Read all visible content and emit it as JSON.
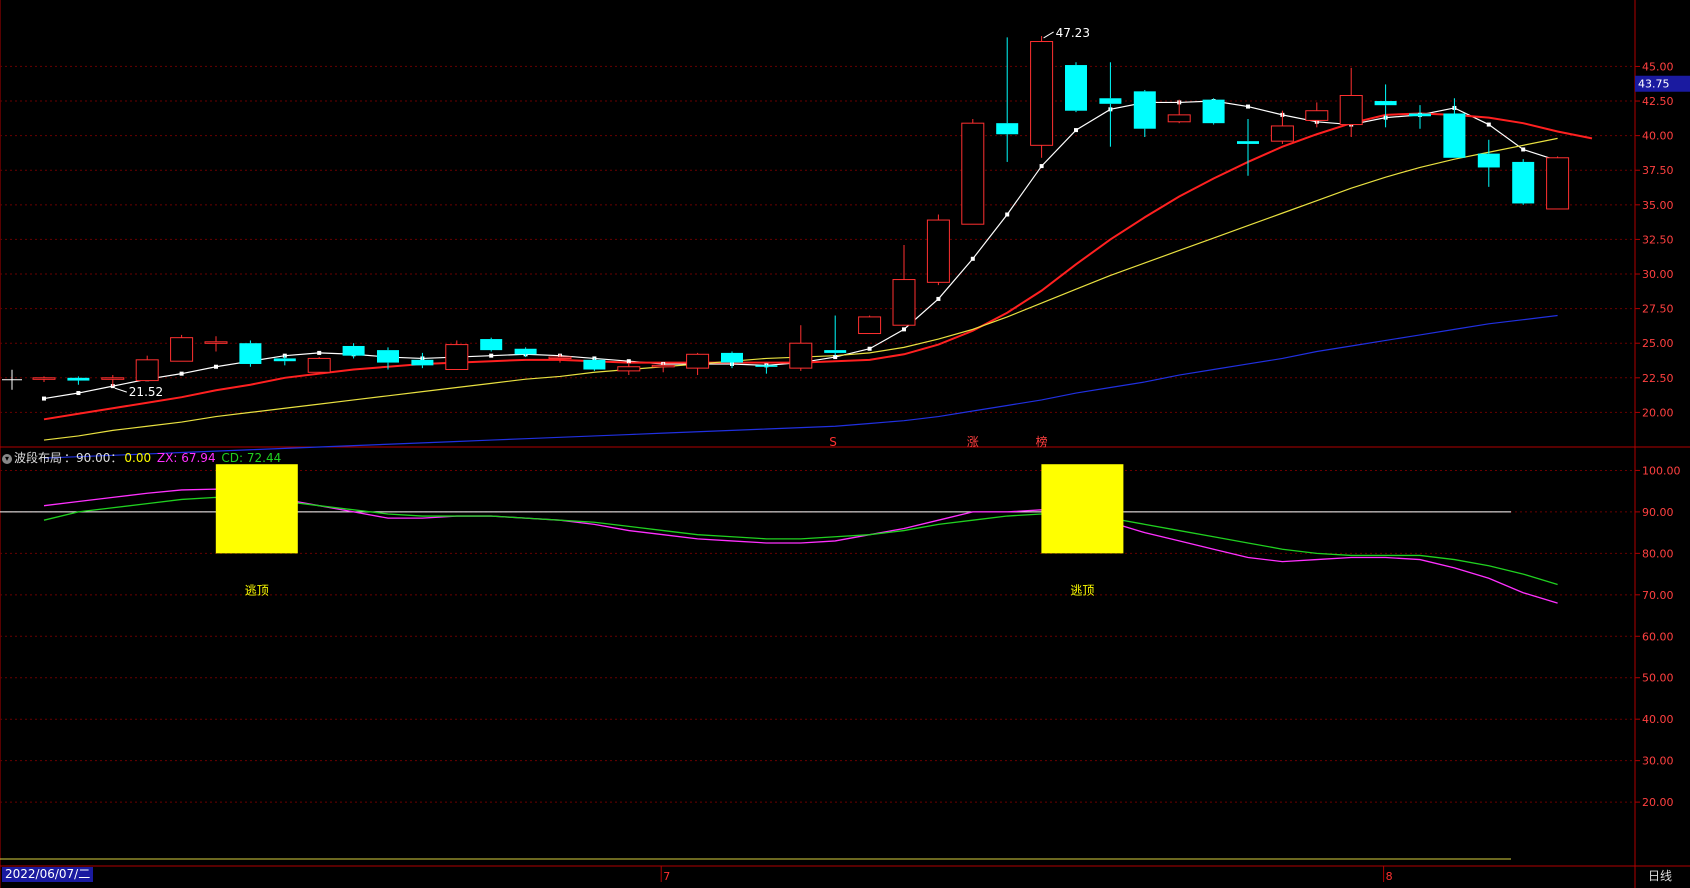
{
  "chart_data": [
    {
      "type": "candlestick",
      "title": "",
      "y_axis_ticks": [
        "45.00",
        "42.50",
        "40.00",
        "37.50",
        "35.00",
        "32.50",
        "30.00",
        "27.50",
        "25.00",
        "22.50",
        "20.00"
      ],
      "ylim": [
        17.5,
        48.5
      ],
      "current_price_tag": "43.75",
      "current_price": 43.75,
      "max_annotation": "47.23",
      "min_annotation": "21.52",
      "candles": [
        {
          "o": 22.4,
          "h": 22.6,
          "l": 22.2,
          "c": 22.5,
          "up": true
        },
        {
          "o": 22.5,
          "h": 22.6,
          "l": 22.0,
          "c": 22.3,
          "up": false
        },
        {
          "o": 22.4,
          "h": 22.7,
          "l": 21.9,
          "c": 22.5,
          "up": true
        },
        {
          "o": 22.3,
          "h": 24.1,
          "l": 22.3,
          "c": 23.8,
          "up": true
        },
        {
          "o": 23.7,
          "h": 25.6,
          "l": 23.7,
          "c": 25.4,
          "up": true
        },
        {
          "o": 25.1,
          "h": 25.5,
          "l": 24.4,
          "c": 25.1,
          "up": true
        },
        {
          "o": 25.0,
          "h": 25.2,
          "l": 23.3,
          "c": 23.5,
          "up": false
        },
        {
          "o": 23.9,
          "h": 24.1,
          "l": 23.4,
          "c": 23.7,
          "up": false
        },
        {
          "o": 22.9,
          "h": 24.0,
          "l": 22.9,
          "c": 23.9,
          "up": true
        },
        {
          "o": 24.8,
          "h": 25.0,
          "l": 23.9,
          "c": 24.1,
          "up": false
        },
        {
          "o": 24.5,
          "h": 24.7,
          "l": 23.1,
          "c": 23.6,
          "up": false
        },
        {
          "o": 23.8,
          "h": 24.3,
          "l": 23.2,
          "c": 23.4,
          "up": false
        },
        {
          "o": 23.1,
          "h": 25.2,
          "l": 23.1,
          "c": 24.9,
          "up": true
        },
        {
          "o": 25.3,
          "h": 25.4,
          "l": 24.4,
          "c": 24.5,
          "up": false
        },
        {
          "o": 24.6,
          "h": 24.7,
          "l": 24.0,
          "c": 24.2,
          "up": false
        },
        {
          "o": 23.9,
          "h": 24.2,
          "l": 23.6,
          "c": 24.0,
          "up": true
        },
        {
          "o": 23.8,
          "h": 23.9,
          "l": 23.0,
          "c": 23.1,
          "up": false
        },
        {
          "o": 23.0,
          "h": 23.6,
          "l": 22.7,
          "c": 23.3,
          "up": true
        },
        {
          "o": 23.3,
          "h": 23.6,
          "l": 22.9,
          "c": 23.4,
          "up": true
        },
        {
          "o": 23.2,
          "h": 24.3,
          "l": 22.7,
          "c": 24.2,
          "up": true
        },
        {
          "o": 24.3,
          "h": 24.4,
          "l": 23.2,
          "c": 23.6,
          "up": false
        },
        {
          "o": 23.4,
          "h": 23.5,
          "l": 22.8,
          "c": 23.3,
          "up": false
        },
        {
          "o": 23.2,
          "h": 26.3,
          "l": 23.0,
          "c": 25.0,
          "up": true
        },
        {
          "o": 24.5,
          "h": 27.0,
          "l": 24.1,
          "c": 24.3,
          "up": false
        },
        {
          "o": 25.7,
          "h": 27.0,
          "l": 25.7,
          "c": 26.9,
          "up": true
        },
        {
          "o": 26.3,
          "h": 32.1,
          "l": 26.3,
          "c": 29.6,
          "up": true
        },
        {
          "o": 29.4,
          "h": 34.3,
          "l": 29.2,
          "c": 33.9,
          "up": true
        },
        {
          "o": 33.6,
          "h": 41.2,
          "l": 33.6,
          "c": 40.9,
          "up": true
        },
        {
          "o": 40.9,
          "h": 47.1,
          "l": 38.1,
          "c": 40.1,
          "up": false
        },
        {
          "o": 39.3,
          "h": 47.2,
          "l": 38.4,
          "c": 46.8,
          "up": true
        },
        {
          "o": 45.1,
          "h": 45.3,
          "l": 41.7,
          "c": 41.8,
          "up": false
        },
        {
          "o": 42.7,
          "h": 45.3,
          "l": 39.2,
          "c": 42.3,
          "up": false
        },
        {
          "o": 43.2,
          "h": 43.3,
          "l": 39.9,
          "c": 40.5,
          "up": false
        },
        {
          "o": 41.0,
          "h": 42.6,
          "l": 40.9,
          "c": 41.5,
          "up": true
        },
        {
          "o": 42.6,
          "h": 42.7,
          "l": 40.8,
          "c": 40.9,
          "up": false
        },
        {
          "o": 39.6,
          "h": 41.2,
          "l": 37.1,
          "c": 39.4,
          "up": false
        },
        {
          "o": 39.6,
          "h": 41.8,
          "l": 39.4,
          "c": 40.7,
          "up": true
        },
        {
          "o": 41.1,
          "h": 42.4,
          "l": 40.6,
          "c": 41.8,
          "up": true
        },
        {
          "o": 40.8,
          "h": 44.9,
          "l": 39.9,
          "c": 42.9,
          "up": true
        },
        {
          "o": 42.5,
          "h": 43.7,
          "l": 40.6,
          "c": 42.2,
          "up": false
        },
        {
          "o": 41.6,
          "h": 42.2,
          "l": 40.5,
          "c": 41.4,
          "up": false
        },
        {
          "o": 41.6,
          "h": 42.7,
          "l": 38.4,
          "c": 38.4,
          "up": false
        },
        {
          "o": 38.7,
          "h": 39.7,
          "l": 36.3,
          "c": 37.7,
          "up": false
        },
        {
          "o": 38.1,
          "h": 38.3,
          "l": 35.0,
          "c": 35.1,
          "up": false
        },
        {
          "o": 34.7,
          "h": 38.5,
          "l": 34.7,
          "c": 38.4,
          "up": true
        }
      ],
      "series": [
        {
          "color": "#ffffff",
          "values": [
            21.0,
            21.4,
            21.9,
            22.4,
            22.8,
            23.3,
            23.7,
            24.1,
            24.3,
            24.2,
            24.0,
            23.9,
            24.0,
            24.1,
            24.2,
            24.1,
            23.9,
            23.7,
            23.5,
            23.5,
            23.5,
            23.4,
            23.6,
            24.0,
            24.6,
            26.0,
            28.2,
            31.1,
            34.3,
            37.8,
            40.4,
            41.9,
            42.4,
            42.4,
            42.5,
            42.1,
            41.5,
            41.0,
            40.8,
            41.3,
            41.5,
            42.0,
            40.8,
            39.0,
            38.2
          ]
        },
        {
          "color": "#ff2020",
          "values": [
            19.5,
            19.9,
            20.3,
            20.7,
            21.1,
            21.6,
            22.0,
            22.5,
            22.8,
            23.1,
            23.3,
            23.5,
            23.6,
            23.7,
            23.8,
            23.8,
            23.7,
            23.6,
            23.6,
            23.6,
            23.6,
            23.6,
            23.6,
            23.7,
            23.8,
            24.2,
            24.9,
            25.9,
            27.2,
            28.8,
            30.7,
            32.5,
            34.1,
            35.6,
            36.9,
            38.1,
            39.2,
            40.1,
            40.9,
            41.5,
            41.6,
            41.5,
            41.3,
            40.9,
            40.3,
            39.8
          ]
        },
        {
          "color": "#e8e040",
          "values": [
            18.0,
            18.3,
            18.7,
            19.0,
            19.3,
            19.7,
            20.0,
            20.3,
            20.6,
            20.9,
            21.2,
            21.5,
            21.8,
            22.1,
            22.4,
            22.6,
            22.9,
            23.1,
            23.3,
            23.5,
            23.7,
            23.9,
            24.0,
            24.1,
            24.3,
            24.7,
            25.3,
            26.0,
            26.9,
            27.9,
            28.9,
            29.9,
            30.8,
            31.7,
            32.6,
            33.5,
            34.4,
            35.3,
            36.2,
            37.0,
            37.7,
            38.3,
            38.8,
            39.3,
            39.8
          ]
        },
        {
          "color": "#2030e0",
          "values": [
            16.7,
            16.8,
            16.9,
            17.0,
            17.1,
            17.2,
            17.3,
            17.4,
            17.5,
            17.6,
            17.7,
            17.8,
            17.9,
            18.0,
            18.1,
            18.2,
            18.3,
            18.4,
            18.5,
            18.6,
            18.7,
            18.8,
            18.9,
            19.0,
            19.2,
            19.4,
            19.7,
            20.1,
            20.5,
            20.9,
            21.4,
            21.8,
            22.2,
            22.7,
            23.1,
            23.5,
            23.9,
            24.4,
            24.8,
            25.2,
            25.6,
            26.0,
            26.4,
            26.7,
            27.0
          ]
        }
      ],
      "signal_marks": [
        {
          "bar": 23,
          "text": "S",
          "color": "#ff3030"
        },
        {
          "bar": 27,
          "text": "涨",
          "color": "#ff4040"
        },
        {
          "bar": 29,
          "text": "榜",
          "color": "#ff4040"
        }
      ]
    },
    {
      "type": "line",
      "indicator_name": "波段布局",
      "param_label": "：90.00：",
      "param_value": "0.00",
      "zx_label": "ZX: 67.94",
      "cd_label": "CD: 72.44",
      "y_axis_ticks": [
        "100.00",
        "90.00",
        "80.00",
        "70.00",
        "60.00",
        "50.00",
        "40.00",
        "30.00",
        "20.00"
      ],
      "ylim": [
        7,
        103
      ],
      "reference_line": 90,
      "series": [
        {
          "name": "ZX",
          "color": "#ff30ff",
          "values": [
            91.5,
            92.5,
            93.5,
            94.5,
            95.3,
            95.5,
            94.5,
            93.0,
            91.5,
            90.0,
            88.5,
            88.5,
            89.0,
            89.0,
            88.5,
            88.0,
            87.0,
            85.5,
            84.5,
            83.5,
            83.0,
            82.5,
            82.5,
            83.0,
            84.5,
            86.0,
            88.0,
            90.0,
            90.0,
            90.5,
            90.0,
            87.5,
            85.0,
            83.0,
            81.0,
            79.0,
            78.0,
            78.5,
            79.0,
            79.0,
            78.5,
            76.5,
            74.0,
            70.5,
            68.0
          ]
        },
        {
          "name": "CD",
          "color": "#20d020",
          "values": [
            88.0,
            90.0,
            91.0,
            92.0,
            93.0,
            93.5,
            93.0,
            92.5,
            91.5,
            90.5,
            89.5,
            89.0,
            89.0,
            89.0,
            88.5,
            88.0,
            87.5,
            86.5,
            85.5,
            84.5,
            84.0,
            83.5,
            83.5,
            84.0,
            84.5,
            85.5,
            87.0,
            88.0,
            89.0,
            89.5,
            89.5,
            88.5,
            87.0,
            85.5,
            84.0,
            82.5,
            81.0,
            80.0,
            79.5,
            79.5,
            79.5,
            78.5,
            77.0,
            75.0,
            72.5
          ]
        }
      ],
      "escape_signals": [
        {
          "bar": 7,
          "text": "逃顶"
        },
        {
          "bar": 31,
          "text": "逃顶"
        }
      ]
    }
  ],
  "footer": {
    "date_label": "2022/06/07/二",
    "period_label": "日线",
    "month_ticks": [
      {
        "bar": 18,
        "text": "7"
      },
      {
        "bar": 39,
        "text": "8"
      }
    ]
  }
}
